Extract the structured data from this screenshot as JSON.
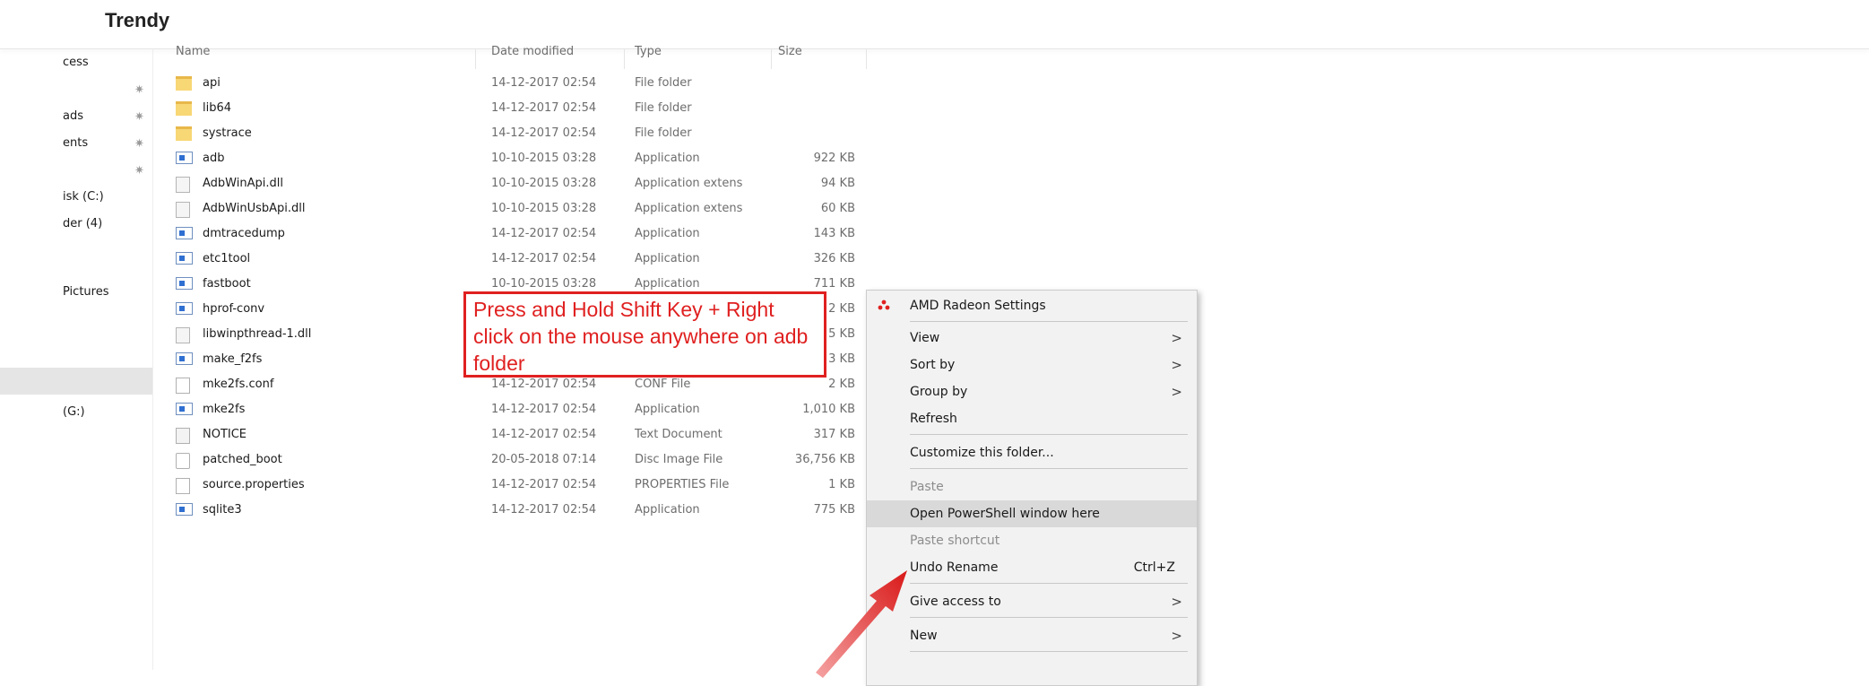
{
  "brand": "Trendy",
  "nav_items": [
    {
      "label": "cess",
      "pinned": false
    },
    {
      "label": "",
      "pinned": true
    },
    {
      "label": "ads",
      "pinned": true
    },
    {
      "label": "ents",
      "pinned": true
    },
    {
      "label": "",
      "pinned": true
    },
    {
      "label": "isk (C:)",
      "pinned": false
    },
    {
      "label": "der (4)",
      "pinned": false
    },
    {
      "label": "Pictures",
      "pinned": false
    },
    {
      "label": "",
      "pinned": false
    },
    {
      "label": "(G:)",
      "pinned": false
    }
  ],
  "columns": {
    "name": "Name",
    "date": "Date modified",
    "type": "Type",
    "size": "Size"
  },
  "files": [
    {
      "name": "api",
      "date": "14-12-2017 02:54",
      "type": "File folder",
      "size": "",
      "icon": "folder"
    },
    {
      "name": "lib64",
      "date": "14-12-2017 02:54",
      "type": "File folder",
      "size": "",
      "icon": "folder"
    },
    {
      "name": "systrace",
      "date": "14-12-2017 02:54",
      "type": "File folder",
      "size": "",
      "icon": "folder"
    },
    {
      "name": "adb",
      "date": "10-10-2015 03:28",
      "type": "Application",
      "size": "922 KB",
      "icon": "app"
    },
    {
      "name": "AdbWinApi.dll",
      "date": "10-10-2015 03:28",
      "type": "Application extens",
      "size": "94 KB",
      "icon": "dll"
    },
    {
      "name": "AdbWinUsbApi.dll",
      "date": "10-10-2015 03:28",
      "type": "Application extens",
      "size": "60 KB",
      "icon": "dll"
    },
    {
      "name": "dmtracedump",
      "date": "14-12-2017 02:54",
      "type": "Application",
      "size": "143 KB",
      "icon": "app"
    },
    {
      "name": "etc1tool",
      "date": "14-12-2017 02:54",
      "type": "Application",
      "size": "326 KB",
      "icon": "app"
    },
    {
      "name": "fastboot",
      "date": "10-10-2015 03:28",
      "type": "Application",
      "size": "711 KB",
      "icon": "app"
    },
    {
      "name": "hprof-conv",
      "date": "",
      "type": "",
      "size": "2 KB",
      "icon": "app"
    },
    {
      "name": "libwinpthread-1.dll",
      "date": "",
      "type": "",
      "size": "5 KB",
      "icon": "dll"
    },
    {
      "name": "make_f2fs",
      "date": "",
      "type": "",
      "size": "3 KB",
      "icon": "app"
    },
    {
      "name": "mke2fs.conf",
      "date": "14-12-2017 02:54",
      "type": "CONF File",
      "size": "2 KB",
      "icon": "doc"
    },
    {
      "name": "mke2fs",
      "date": "14-12-2017 02:54",
      "type": "Application",
      "size": "1,010 KB",
      "icon": "app"
    },
    {
      "name": "NOTICE",
      "date": "14-12-2017 02:54",
      "type": "Text Document",
      "size": "317 KB",
      "icon": "txt"
    },
    {
      "name": "patched_boot",
      "date": "20-05-2018 07:14",
      "type": "Disc Image File",
      "size": "36,756 KB",
      "icon": "img"
    },
    {
      "name": "source.properties",
      "date": "14-12-2017 02:54",
      "type": "PROPERTIES File",
      "size": "1 KB",
      "icon": "doc"
    },
    {
      "name": "sqlite3",
      "date": "14-12-2017 02:54",
      "type": "Application",
      "size": "775 KB",
      "icon": "app"
    }
  ],
  "callout": {
    "text": "Press and Hold Shift Key + Right click on the mouse anywhere on adb folder",
    "color": "#e02020"
  },
  "context_menu": {
    "items": [
      {
        "label": "AMD Radeon Settings",
        "icon": "amd-radeon-icon"
      },
      {
        "label": "View",
        "submenu": true
      },
      {
        "label": "Sort by",
        "submenu": true
      },
      {
        "label": "Group by",
        "submenu": true
      },
      {
        "label": "Refresh"
      },
      {
        "label": "Customize this folder..."
      },
      {
        "label": "Paste",
        "disabled": true
      },
      {
        "label": "Open PowerShell window here",
        "highlighted": true
      },
      {
        "label": "Paste shortcut",
        "disabled": true
      },
      {
        "label": "Undo Rename",
        "shortcut": "Ctrl+Z"
      },
      {
        "label": "Give access to",
        "submenu": true
      },
      {
        "label": "New",
        "submenu": true
      }
    ],
    "submenu_glyph": ">"
  }
}
